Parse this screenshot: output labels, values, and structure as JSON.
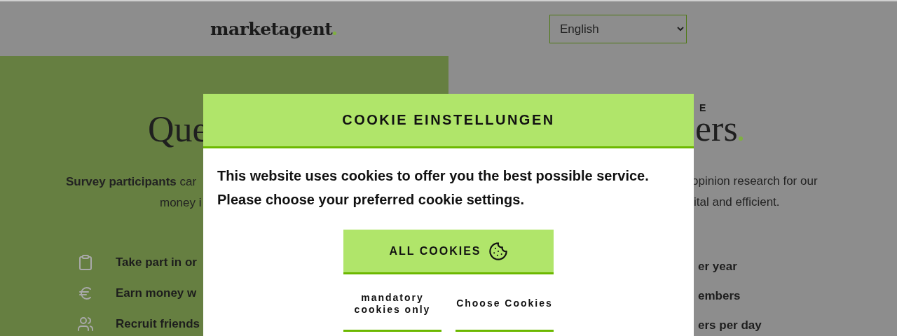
{
  "header": {
    "logo": "marketagent",
    "language": {
      "value": "English"
    }
  },
  "left_column": {
    "headline": "Que",
    "intro": [
      "**Survey participants** car",
      "money i"
    ],
    "features": [
      "Take part in or",
      "Earn money w",
      "Recruit friends"
    ]
  },
  "right_column": {
    "eyebrow": "E",
    "headline": "ers",
    "intro": [
      "opinion research for our",
      "ital and efficient."
    ],
    "features": [
      "er year",
      "embers",
      "ers per day"
    ]
  },
  "cookie_dialog": {
    "title": "COOKIE EINSTELLUNGEN",
    "message": [
      "This website uses cookies to offer you the best possible service.",
      "Please choose your preferred cookie settings."
    ],
    "primary_button": "ALL COOKIES",
    "secondary_buttons": [
      "mandatory cookies only",
      "Choose Cookies"
    ]
  }
}
